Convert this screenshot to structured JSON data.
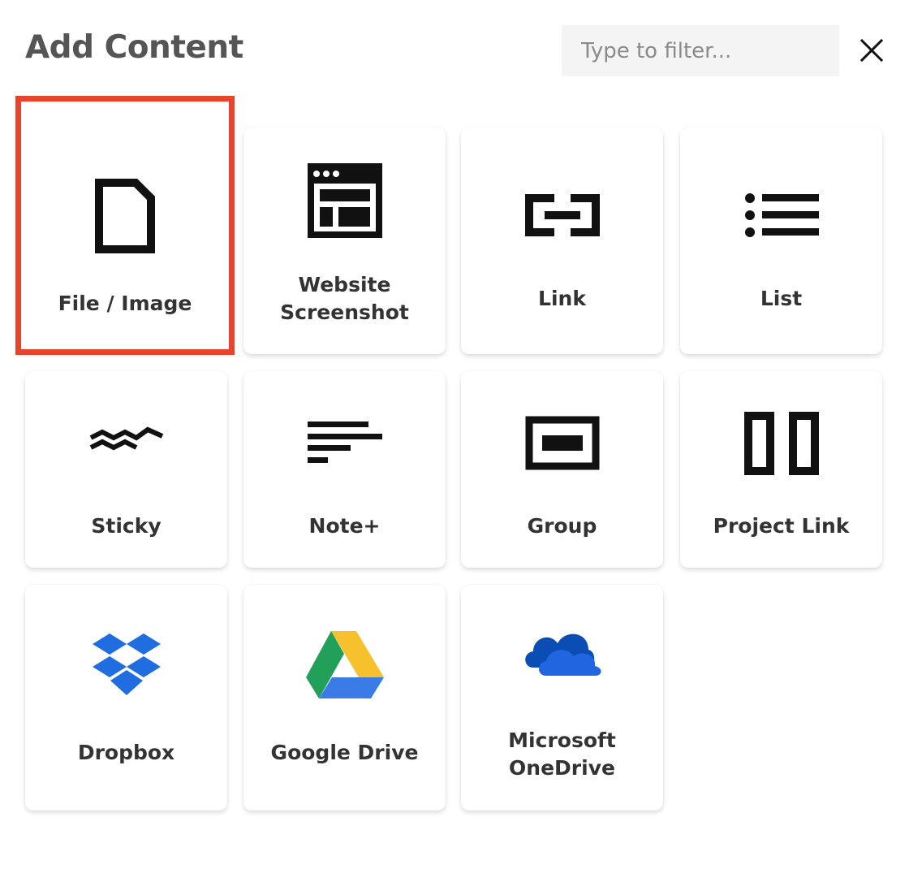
{
  "header": {
    "title": "Add Content",
    "filter_placeholder": "Type to filter...",
    "close_icon": "close-icon"
  },
  "selection_color": "#e8442c",
  "tiles": [
    {
      "label": "File / Image",
      "icon": "file-icon",
      "selected": true
    },
    {
      "label": "Website Screenshot",
      "icon": "browser-window-icon"
    },
    {
      "label": "Link",
      "icon": "link-icon"
    },
    {
      "label": "List",
      "icon": "bullet-list-icon"
    },
    {
      "label": "Sticky",
      "icon": "sticky-wave-icon"
    },
    {
      "label": "Note+",
      "icon": "text-lines-icon"
    },
    {
      "label": "Group",
      "icon": "group-frame-icon"
    },
    {
      "label": "Project Link",
      "icon": "project-columns-icon"
    },
    {
      "label": "Dropbox",
      "icon": "dropbox-logo-icon"
    },
    {
      "label": "Google Drive",
      "icon": "google-drive-logo-icon"
    },
    {
      "label": "Microsoft OneDrive",
      "icon": "onedrive-cloud-icon"
    }
  ]
}
